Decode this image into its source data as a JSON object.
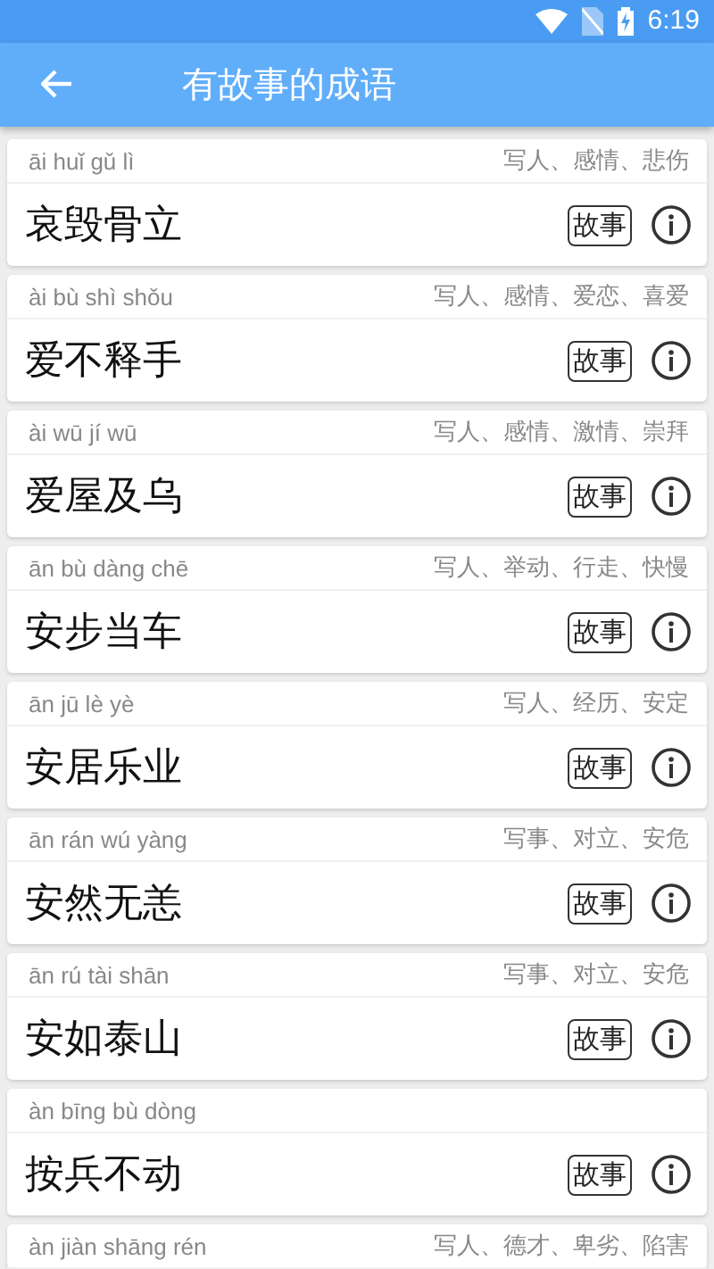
{
  "status_bar": {
    "time": "6:19"
  },
  "app_bar": {
    "title": "有故事的成语"
  },
  "idioms": [
    {
      "pinyin": "āi huǐ gǔ lì",
      "tags": "写人、感情、悲伤",
      "word": "哀毁骨立",
      "story": "故事"
    },
    {
      "pinyin": "ài bù shì shǒu",
      "tags": "写人、感情、爱恋、喜爱",
      "word": "爱不释手",
      "story": "故事"
    },
    {
      "pinyin": "ài wū jí wū",
      "tags": "写人、感情、激情、崇拜",
      "word": "爱屋及乌",
      "story": "故事"
    },
    {
      "pinyin": "ān bù dàng chē",
      "tags": "写人、举动、行走、快慢",
      "word": "安步当车",
      "story": "故事"
    },
    {
      "pinyin": "ān jū lè yè",
      "tags": "写人、经历、安定",
      "word": "安居乐业",
      "story": "故事"
    },
    {
      "pinyin": "ān rán wú yàng",
      "tags": "写事、对立、安危",
      "word": "安然无恙",
      "story": "故事"
    },
    {
      "pinyin": "ān rú tài shān",
      "tags": "写事、对立、安危",
      "word": "安如泰山",
      "story": "故事"
    },
    {
      "pinyin": "àn bīng bù dòng",
      "word": "按兵不动",
      "story": "故事"
    },
    {
      "pinyin": "àn jiàn shāng rén",
      "tags": "写人、德才、卑劣、陷害"
    }
  ]
}
